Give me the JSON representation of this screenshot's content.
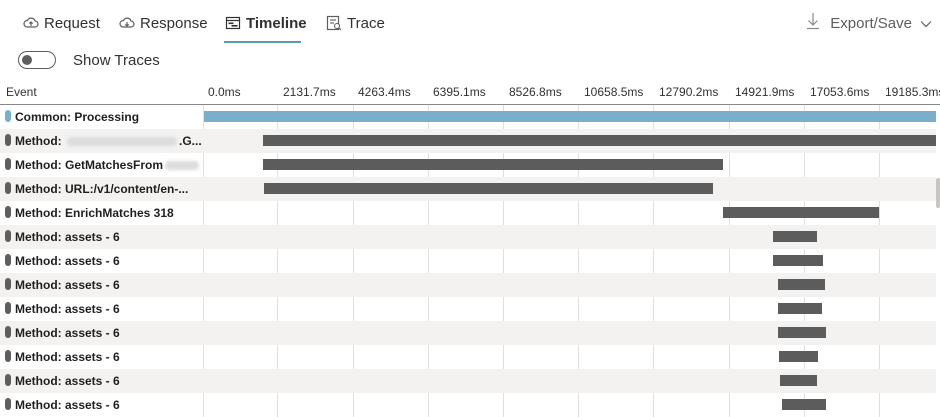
{
  "tabs": [
    {
      "label": "Request",
      "icon": "cloud-upload-icon",
      "active": false
    },
    {
      "label": "Response",
      "icon": "cloud-download-icon",
      "active": false
    },
    {
      "label": "Timeline",
      "icon": "timeline-icon",
      "active": true
    },
    {
      "label": "Trace",
      "icon": "trace-icon",
      "active": false
    }
  ],
  "export": {
    "label": "Export/Save",
    "icon": "download-icon"
  },
  "toggle": {
    "label": "Show Traces",
    "on": false
  },
  "grid": {
    "event_header": "Event",
    "ticks": [
      "0.0ms",
      "2131.7ms",
      "4263.4ms",
      "6395.1ms",
      "8526.8ms",
      "10658.5ms",
      "12790.2ms",
      "14921.9ms",
      "17053.6ms",
      "19185.3ms"
    ]
  },
  "rows": [
    {
      "label": "Common: Processing",
      "type": "common"
    },
    {
      "label_pre": "Method: ",
      "label_post": ".G...",
      "redacted": true
    },
    {
      "label_pre": "Method: GetMatchesFrom",
      "label_post": "",
      "redacted": true
    },
    {
      "label": "Method: URL:/v1/content/en-..."
    },
    {
      "label": "Method: EnrichMatches 318"
    },
    {
      "label": "Method: assets - 6"
    },
    {
      "label": "Method: assets - 6"
    },
    {
      "label": "Method: assets - 6"
    },
    {
      "label": "Method: assets - 6"
    },
    {
      "label": "Method: assets - 6"
    },
    {
      "label": "Method: assets - 6"
    },
    {
      "label": "Method: assets - 6"
    },
    {
      "label": "Method: assets - 6"
    }
  ],
  "colors": {
    "accent": "#5b9ab5",
    "bar": "#5c5c5c",
    "common_bar": "#7aaecb",
    "alt_row": "#f3f2f1"
  }
}
